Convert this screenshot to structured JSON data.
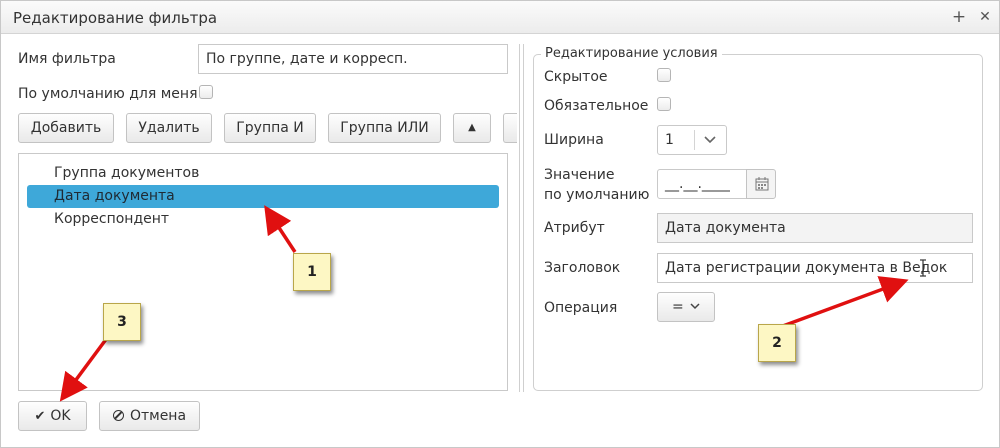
{
  "window": {
    "title": "Редактирование фильтра",
    "maximize_glyph": "+",
    "close_glyph": "✕"
  },
  "left": {
    "filter_name_label": "Имя фильтра",
    "filter_name_value": "По группе, дате и корресп.",
    "default_label": "По умолчанию для меня",
    "default_checked": false,
    "toolbar": {
      "add": "Добавить",
      "delete": "Удалить",
      "group_and": "Группа И",
      "group_or": "Группа ИЛИ",
      "up_glyph": "▲"
    },
    "tree_items": [
      {
        "label": "Группа документов",
        "selected": false
      },
      {
        "label": "Дата документа",
        "selected": true
      },
      {
        "label": "Корреспондент",
        "selected": false
      }
    ]
  },
  "condition": {
    "legend": "Редактирование условия",
    "hidden_label": "Скрытое",
    "hidden_checked": false,
    "required_label": "Обязательное",
    "required_checked": false,
    "width_label": "Ширина",
    "width_value": "1",
    "default_value_label_line1": "Значение",
    "default_value_label_line2": "по умолчанию",
    "default_value_mask": "__.__.____",
    "attribute_label": "Атрибут",
    "attribute_value": "Дата документа",
    "header_label": "Заголовок",
    "header_value": "Дата регистрации документа в Ведок",
    "operation_label": "Операция",
    "operation_value": "="
  },
  "footer": {
    "ok_label": "OK",
    "cancel_label": "Отмена"
  },
  "annotations": {
    "callout_1": "1",
    "callout_2": "2",
    "callout_3": "3",
    "arrow_color": "#e01010",
    "callout_fill": "#fdf7c4"
  },
  "colors": {
    "selection": "#3ea8d9"
  }
}
